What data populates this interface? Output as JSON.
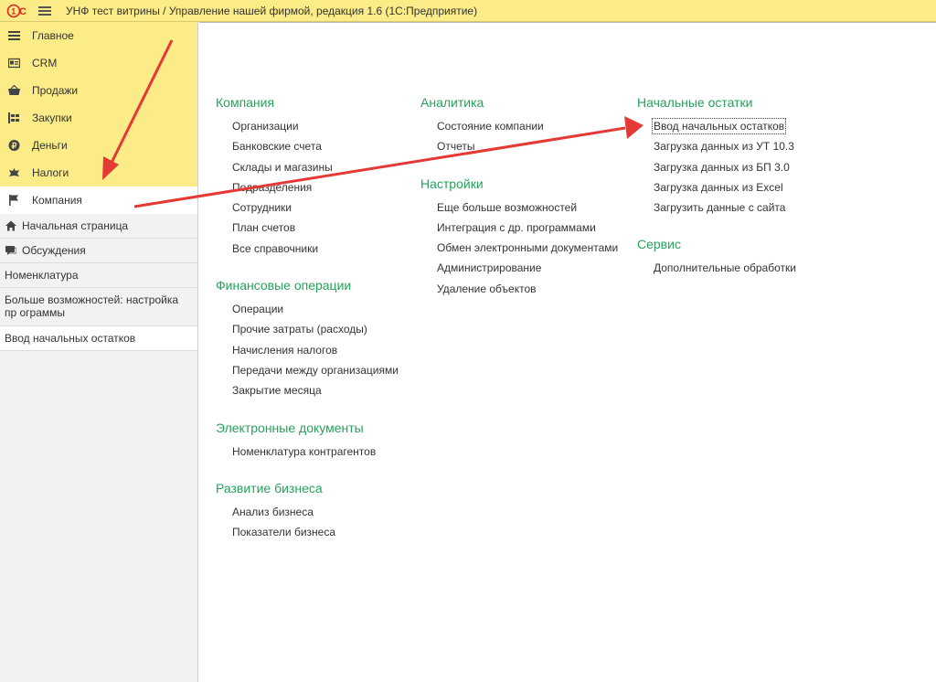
{
  "titlebar": {
    "logo_text": "1С",
    "title": "УНФ тест витрины / Управление нашей фирмой, редакция 1.6  (1С:Предприятие)"
  },
  "sidebar": {
    "sections": [
      {
        "label": "Главное",
        "icon": "list-icon"
      },
      {
        "label": "CRM",
        "icon": "crm-card-icon"
      },
      {
        "label": "Продажи",
        "icon": "basket-icon"
      },
      {
        "label": "Закупки",
        "icon": "supply-icon"
      },
      {
        "label": "Деньги",
        "icon": "ruble-coin-icon"
      },
      {
        "label": "Налоги",
        "icon": "emblem-icon"
      },
      {
        "label": "Компания",
        "icon": "flag-icon"
      }
    ],
    "active_section": "Компания",
    "open_windows": [
      {
        "label": "Начальная страница",
        "icon": "home-icon"
      },
      {
        "label": "Обсуждения",
        "icon": "chat-icon"
      },
      {
        "label": "Номенклатура"
      },
      {
        "label": "Больше возможностей: настройка пр ограммы"
      },
      {
        "label": "Ввод начальных остатков"
      }
    ]
  },
  "main": {
    "columns": [
      [
        {
          "title": "Компания",
          "links": [
            "Организации",
            "Банковские счета",
            "Склады и магазины",
            "Подразделения",
            "Сотрудники",
            "План счетов",
            "Все справочники"
          ]
        },
        {
          "title": "Финансовые операции",
          "links": [
            "Операции",
            "Прочие затраты (расходы)",
            "Начисления налогов",
            "Передачи между организациями",
            "Закрытие месяца"
          ]
        },
        {
          "title": "Электронные документы",
          "links": [
            "Номенклатура контрагентов"
          ]
        },
        {
          "title": "Развитие бизнеса",
          "links": [
            "Анализ бизнеса",
            "Показатели бизнеса"
          ]
        }
      ],
      [
        {
          "title": "Аналитика",
          "links": [
            "Состояние компании",
            "Отчеты"
          ]
        },
        {
          "title": "Настройки",
          "links": [
            "Еще больше возможностей",
            "Интеграция с др. программами",
            "Обмен электронными документами",
            "Администрирование",
            "Удаление объектов"
          ]
        }
      ],
      [
        {
          "title": "Начальные остатки",
          "links": [
            "Ввод начальных остатков",
            "Загрузка данных из УТ 10.3",
            "Загрузка данных из БП 3.0",
            "Загрузка данных из Excel",
            "Загрузить данные с сайта"
          ]
        },
        {
          "title": "Сервис",
          "links": [
            "Дополнительные обработки"
          ]
        }
      ]
    ],
    "focused_link": "Ввод начальных остатков"
  },
  "colors": {
    "panel_yellow": "#fbec88",
    "group_title_green": "#27a15b",
    "annotation_red": "#e53935"
  }
}
